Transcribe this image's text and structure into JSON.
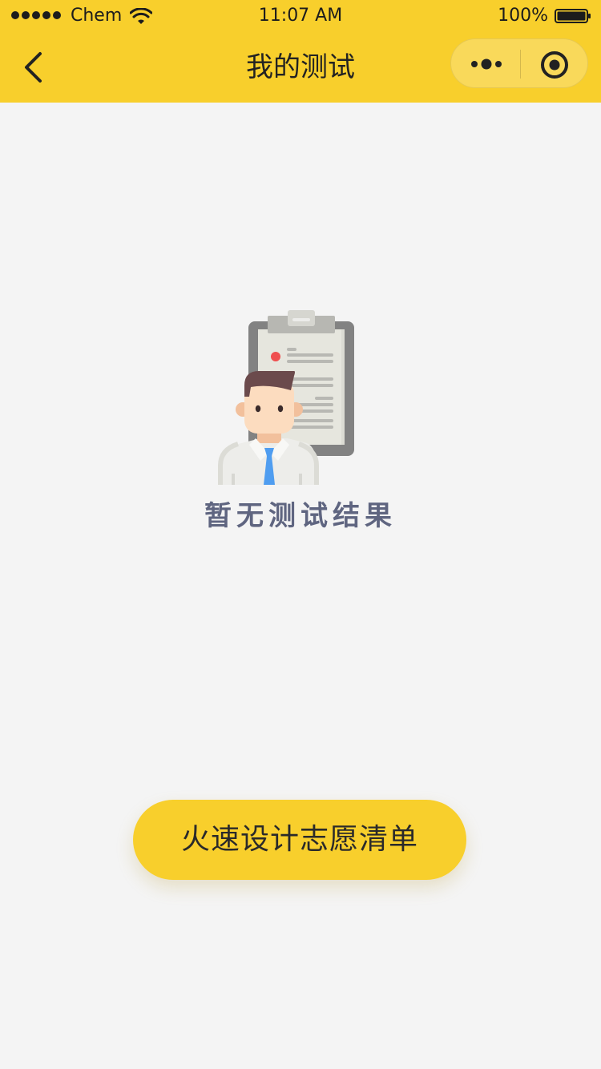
{
  "status_bar": {
    "carrier": "Chem",
    "time": "11:07 AM",
    "battery": "100%",
    "signal_bars": 5
  },
  "nav": {
    "title": "我的测试",
    "back_icon": "chevron-left-icon",
    "more_icon": "more-dots-icon",
    "close_icon": "target-close-icon"
  },
  "empty_state": {
    "message": "暂无测试结果",
    "illustration_icon": "person-clipboard-illustration"
  },
  "cta": {
    "label": "火速设计志愿清单"
  },
  "colors": {
    "brand_yellow": "#f8cf2c",
    "background": "#f4f4f4",
    "empty_text": "#5f6580",
    "tie_blue": "#4f9df0"
  }
}
